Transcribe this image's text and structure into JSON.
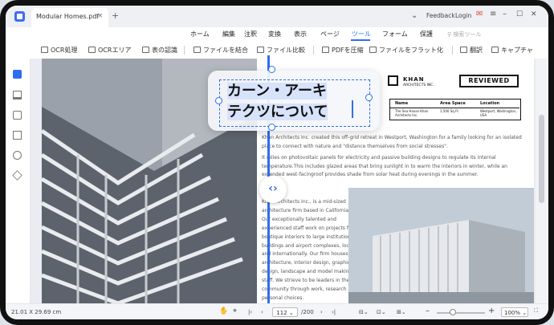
{
  "app": {
    "tab_title": "Modular Homes.pdf",
    "tab_close": "×",
    "tab_add": "+",
    "feedback": "Feedback",
    "login": "Login",
    "minimize": "–",
    "maximize": "☐",
    "close": "✕"
  },
  "menu": {
    "items": [
      "ホーム",
      "編集",
      "注釈",
      "変換",
      "表示",
      "ページ",
      "ツール",
      "フォーム",
      "保護"
    ],
    "active": "ツール",
    "search_placeholder": "検索ツール"
  },
  "toolbar": {
    "items": [
      "OCR処理",
      "OCRエリア",
      "表の認識",
      "ファイルを結合",
      "ファイル比較",
      "PDFを圧縮",
      "ファイルをフラット化",
      "翻訳",
      "キャプチャ"
    ]
  },
  "ocr": {
    "line1": "カーン・アーキ",
    "line2": "テクツについて"
  },
  "document": {
    "company": "KHAN",
    "company_sub": "ARCHITECTS INC.",
    "reviewed": "REVIEWED",
    "table_headers": [
      "Name",
      "Area Space",
      "Location"
    ],
    "table_values": [
      "The Sea House Khan Architects Inc.",
      "1,500 Sq Ft",
      "Westport, Washington, USA"
    ],
    "para1": "Khan Architects Inc. created this off-grid retreat in Westport, Washington for a family looking for an isolated place to connect with nature and \"distance themselves from social stresses\".",
    "para2": "It relies on photovoltaic panels for electricity and passive building designs to regulate its internal temperature.This includes glazed areas that bring sunlight in to warm the interiors in winter, while an extended west-facingroof provides shade from solar heat during evenings in the summer.",
    "para3": "Khan Architects Inc., is a mid-sized architecture firm based in California, USA. Our exceptionally talented and experienced staff work on projects from boutique interiors to large institutional buildings and airport complexes, locally and internationally. Our firm houses their architecture, interior design, graphic design, landscape and model making staff. We strieve to be leaders in the community through work, research and personal choices."
  },
  "status": {
    "dimensions": "21.01 X 29.69 cm",
    "page_current": "112",
    "page_total": "/200",
    "zoom": "100%",
    "zoom_fraction": 0.3
  }
}
